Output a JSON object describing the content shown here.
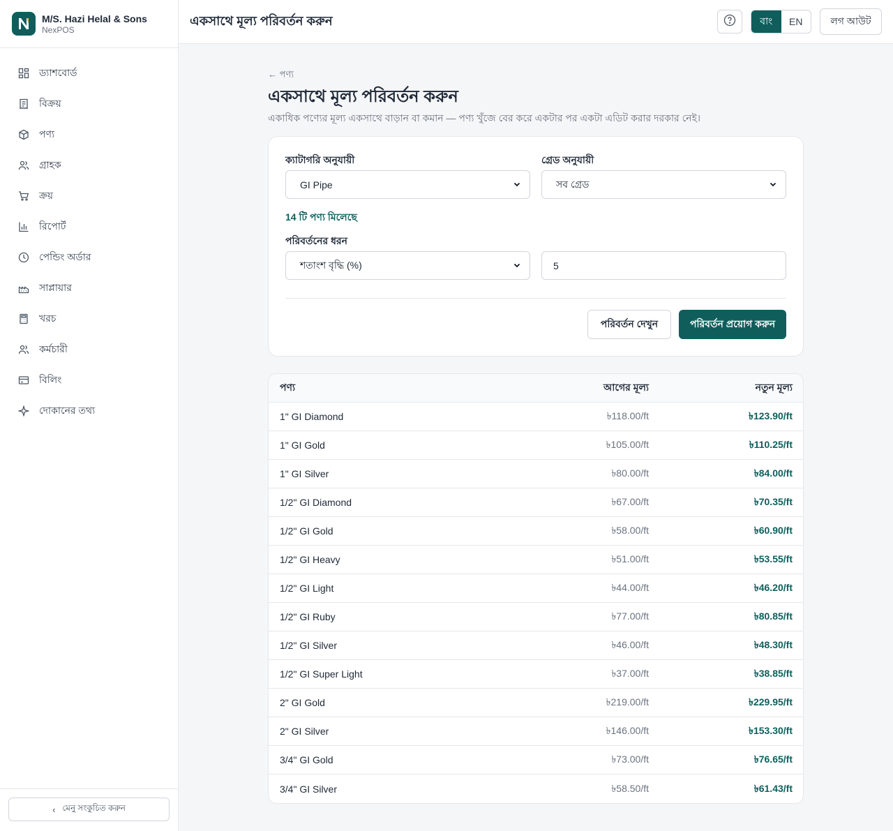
{
  "brand": {
    "name": "M/S. Hazi Helal & Sons",
    "app": "NexPOS"
  },
  "sidebar": {
    "items": [
      {
        "label": "ড্যাশবোর্ড",
        "icon": "dashboard-icon"
      },
      {
        "label": "বিক্রয়",
        "icon": "receipt-icon"
      },
      {
        "label": "পণ্য",
        "icon": "box-icon"
      },
      {
        "label": "গ্রাহক",
        "icon": "users-icon"
      },
      {
        "label": "ক্রয়",
        "icon": "cart-icon"
      },
      {
        "label": "রিপোর্ট",
        "icon": "bar-chart-icon"
      },
      {
        "label": "পেন্ডিং অর্ডার",
        "icon": "clock-icon"
      },
      {
        "label": "সাপ্লায়ার",
        "icon": "factory-icon"
      },
      {
        "label": "খরচ",
        "icon": "calculator-icon"
      },
      {
        "label": "কর্মচারী",
        "icon": "staff-icon"
      },
      {
        "label": "বিলিং",
        "icon": "credit-card-icon"
      },
      {
        "label": "দোকানের তথ্য",
        "icon": "sparkle-icon"
      }
    ],
    "collapse_label": "মেনু সংকুচিত করুন"
  },
  "header": {
    "title": "একসাথে মূল্য পরিবর্তন করুন",
    "lang_bn": "বাং",
    "lang_en": "EN",
    "logout": "লগ আউট"
  },
  "page": {
    "back": "← পণ্য",
    "title": "একসাথে মূল্য পরিবর্তন করুন",
    "description": "একাধিক পণ্যের মূল্য একসাথে বাড়ান বা কমান — পণ্য খুঁজে বের করে একটার পর একটা এডিট করার দরকার নেই।"
  },
  "form": {
    "category_label": "ক্যাটাগরি অনুযায়ী",
    "category_value": "GI Pipe",
    "grade_label": "গ্রেড অনুযায়ী",
    "grade_value": "সব গ্রেড",
    "found_text": "14 টি পণ্য মিলেছে",
    "change_type_label": "পরিবর্তনের ধরন",
    "change_type_value": "শতাংশ বৃদ্ধি (%)",
    "amount_value": "5",
    "preview_button": "পরিবর্তন দেখুন",
    "apply_button": "পরিবর্তন প্রয়োগ করুন"
  },
  "table": {
    "headers": [
      "পণ্য",
      "আগের মূল্য",
      "নতুন মূল্য"
    ],
    "rows": [
      [
        "1\" GI Diamond",
        "৳118.00/ft",
        "৳123.90/ft"
      ],
      [
        "1\" GI Gold",
        "৳105.00/ft",
        "৳110.25/ft"
      ],
      [
        "1\" GI Silver",
        "৳80.00/ft",
        "৳84.00/ft"
      ],
      [
        "1/2\" GI Diamond",
        "৳67.00/ft",
        "৳70.35/ft"
      ],
      [
        "1/2\" GI Gold",
        "৳58.00/ft",
        "৳60.90/ft"
      ],
      [
        "1/2\" GI Heavy",
        "৳51.00/ft",
        "৳53.55/ft"
      ],
      [
        "1/2\" GI Light",
        "৳44.00/ft",
        "৳46.20/ft"
      ],
      [
        "1/2\" GI Ruby",
        "৳77.00/ft",
        "৳80.85/ft"
      ],
      [
        "1/2\" GI Silver",
        "৳46.00/ft",
        "৳48.30/ft"
      ],
      [
        "1/2\" GI Super Light",
        "৳37.00/ft",
        "৳38.85/ft"
      ],
      [
        "2\" GI Gold",
        "৳219.00/ft",
        "৳229.95/ft"
      ],
      [
        "2\" GI Silver",
        "৳146.00/ft",
        "৳153.30/ft"
      ],
      [
        "3/4\" GI Gold",
        "৳73.00/ft",
        "৳76.65/ft"
      ],
      [
        "3/4\" GI Silver",
        "৳58.50/ft",
        "৳61.43/ft"
      ]
    ]
  },
  "colors": {
    "primary": "#0f5e5c",
    "border": "#e5e7eb",
    "background": "#f5f6f7"
  }
}
